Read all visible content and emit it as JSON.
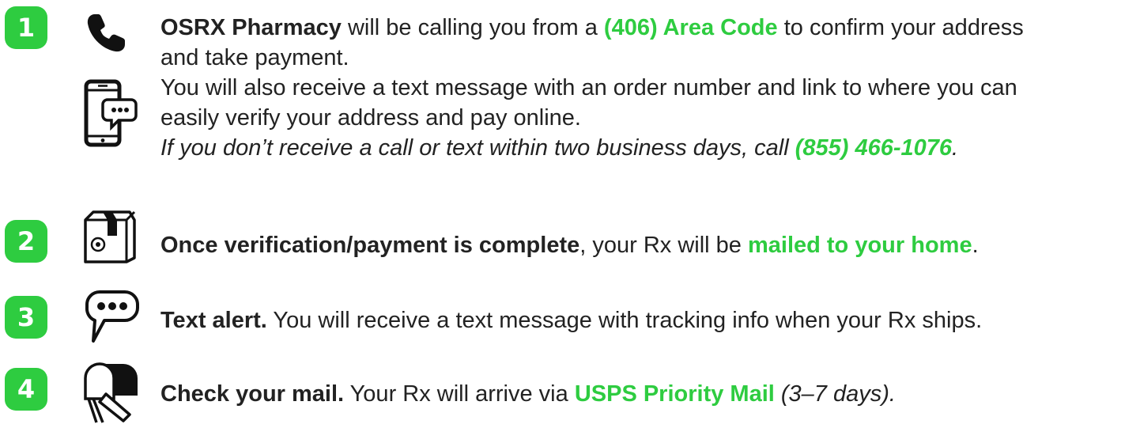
{
  "steps": [
    {
      "number": "1",
      "lines": [
        {
          "b1": "OSRX Pharmacy",
          "t1": " will be calling you from a ",
          "g1": "(406) Area Code",
          "t2": " to confirm your address"
        },
        {
          "t1": "and take payment."
        },
        {
          "t1": "You will also receive a text message with an order number and link to where you can"
        },
        {
          "t1": "easily verify your address and pay online."
        },
        {
          "i1": "If you don’t receive a call or text within two business days, call ",
          "g1": "(855) 466-1076",
          "i2": "."
        }
      ]
    },
    {
      "number": "2",
      "b1": "Once verification/payment is complete",
      "t1": ", your Rx will be ",
      "g1": "mailed to your home",
      "t2": "."
    },
    {
      "number": "3",
      "b1": "Text alert.",
      "t1": " You will receive a text message with tracking info when your Rx ships."
    },
    {
      "number": "4",
      "b1": "Check your mail.",
      "t1": " Your Rx will arrive via ",
      "g1": "USPS Priority Mail",
      "i1": " (3–7 days)."
    }
  ],
  "icons": [
    "phone-icon",
    "smartphone-chat-icon",
    "package-box-icon",
    "speech-bubble-icon",
    "mailbox-icon"
  ],
  "colors": {
    "accent": "#2ecc40",
    "text": "#222222",
    "icon": "#111111"
  }
}
